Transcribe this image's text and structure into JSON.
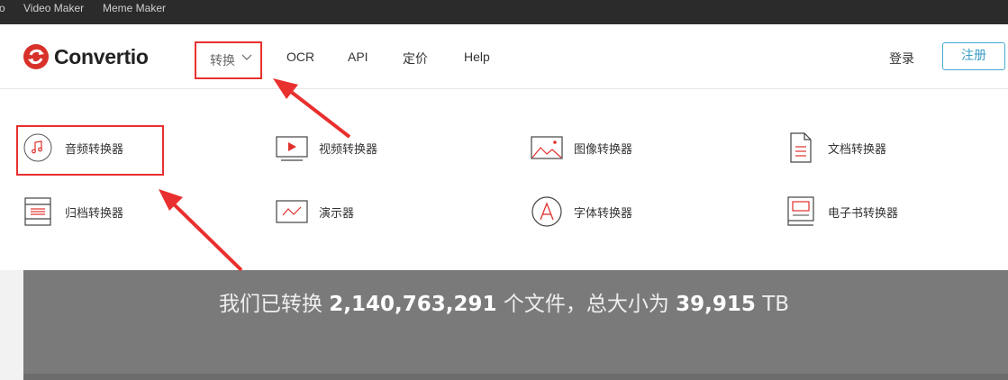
{
  "topbar": {
    "partial_label": "o",
    "items": [
      "Video Maker",
      "Meme Maker"
    ]
  },
  "header": {
    "logo_text": "Convertio",
    "nav": {
      "convert": "转换",
      "ocr": "OCR",
      "api": "API",
      "pricing": "定价",
      "help": "Help"
    },
    "login": "登录",
    "signup": "注册"
  },
  "menu": {
    "items": [
      {
        "label": "音频转换器",
        "icon": "music-note-icon"
      },
      {
        "label": "视频转换器",
        "icon": "video-play-icon"
      },
      {
        "label": "图像转换器",
        "icon": "image-icon"
      },
      {
        "label": "文档转换器",
        "icon": "document-icon"
      },
      {
        "label": "归档转换器",
        "icon": "archive-icon"
      },
      {
        "label": "演示器",
        "icon": "presentation-icon"
      },
      {
        "label": "字体转换器",
        "icon": "font-icon"
      },
      {
        "label": "电子书转换器",
        "icon": "ebook-icon"
      }
    ]
  },
  "banner": {
    "prefix": "我们已转换",
    "files_count": "2,140,763,291",
    "middle": "个文件，总大小为",
    "total_size": "39,915",
    "unit": "TB"
  },
  "colors": {
    "brand_red": "#d8312a",
    "annotation_red": "#e8302e",
    "signup_blue": "#47a9cf",
    "banner_gray": "#7a7a7a"
  }
}
